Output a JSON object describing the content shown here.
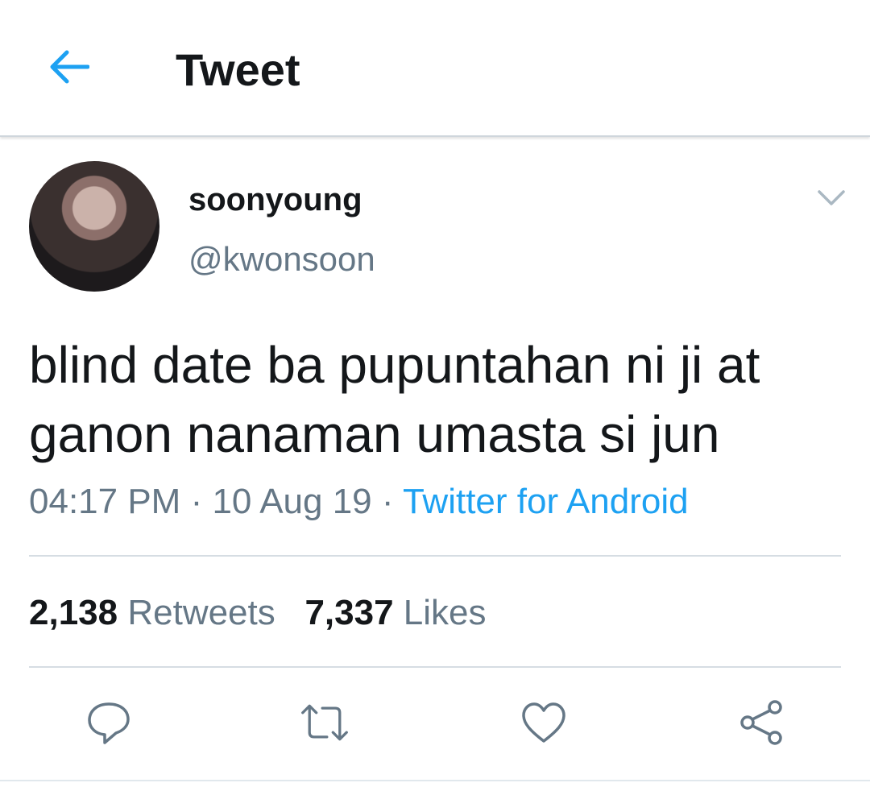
{
  "header": {
    "back_icon": "back-arrow-icon",
    "title": "Tweet"
  },
  "tweet": {
    "author": {
      "display_name": "soonyoung",
      "handle": "@kwonsoon"
    },
    "more_icon": "chevron-down-icon",
    "text": "blind date ba pupuntahan ni ji at\nganon nanaman umasta si jun",
    "time": "04:17 PM",
    "separator": " · ",
    "date": "10 Aug 19",
    "source": "Twitter for Android",
    "stats": {
      "retweets_count": "2,138",
      "retweets_label": "Retweets",
      "likes_count": "7,337",
      "likes_label": "Likes"
    },
    "actions": [
      "reply-icon",
      "retweet-icon",
      "like-icon",
      "share-icon"
    ]
  },
  "colors": {
    "accent": "#1da1f2",
    "text_primary": "#14171a",
    "text_secondary": "#657786",
    "divider": "#d6dde3"
  }
}
